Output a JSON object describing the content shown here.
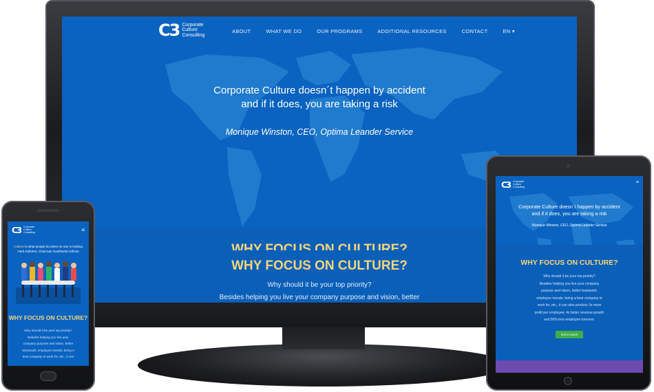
{
  "brand": {
    "line1": "Corporate",
    "line2": "Culture",
    "line3": "Consulting"
  },
  "nav": {
    "items": [
      "ABOUT",
      "WHAT WE DO",
      "OUR PROGRAMS",
      "ADDITIONAL RESOURCES",
      "CONTACT"
    ],
    "lang": "EN"
  },
  "hero": {
    "quote_line1": "Corporate Culture doesn´t happen by accident",
    "quote_line2": "and if it does, you are taking a risk",
    "author": "Monique Winston, CEO, Optima Leander Service"
  },
  "why": {
    "title": "WHY FOCUS ON CULTURE?",
    "sub": "Why should it be your top priority?",
    "text": "Besides helping you live your company purpose and vision, better"
  },
  "phone": {
    "culture_word": "Culture",
    "culture_rest": " is what people do when no one is looking",
    "attribution": "Herb Kelleher, Chairman Southwest Airlines",
    "why_title": "WHY FOCUS ON CULTURE?",
    "p1": "Why should it be your top priority?",
    "p2": "Besides helping you live your",
    "p3": "company purpose and vision, better",
    "p4": "teamwork, employee morale, being a",
    "p5": "best company to work for, etc., it can"
  },
  "tablet": {
    "quote_line1": "Corporate Culture doesn´t happen by accident",
    "quote_line2": "and if it does, you are taking a risk",
    "author": "Monique Winston, CEO, Optima Leander Service",
    "why_title": "WHY FOCUS ON CULTURE?",
    "p1": "Why should it be your top priority?",
    "p2": "Besides helping you live your company",
    "p3": "purpose and vision, better teamwork,",
    "p4": "employee morale, being a best company to",
    "p5": "work for, etc., it can also produce 3x more",
    "p6": "profit per employee, 4x faster revenue growth",
    "p7": "and 50% less employee turnover.",
    "cta": "Get in touch"
  },
  "colors": {
    "screen_blue": "#0a63c0",
    "title_yellow": "#f5d77a",
    "cta_green": "#3fae49",
    "footer_purple": "#6d4ab0"
  },
  "icons": [
    "hamburger-icon",
    "brand-logo-icon",
    "chevron-down-icon"
  ]
}
